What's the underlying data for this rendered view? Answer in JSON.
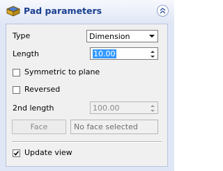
{
  "header": {
    "title": "Pad parameters",
    "icon": "pad-icon",
    "collapse_icon": "chevron-up-icon"
  },
  "type": {
    "label": "Type",
    "selected": "Dimension"
  },
  "length": {
    "label": "Length",
    "value": "10.00"
  },
  "symmetric": {
    "label": "Symmetric to plane",
    "checked": false
  },
  "reversed": {
    "label": "Reversed",
    "checked": false
  },
  "length2": {
    "label": "2nd length",
    "value": "100.00"
  },
  "face": {
    "button_label": "Face",
    "value": "No face selected"
  },
  "update_view": {
    "label": "Update view",
    "checked": true
  },
  "colors": {
    "header_title": "#1a3f8f",
    "panel_bg": "#dfe6f5",
    "selection": "#3399ff"
  }
}
